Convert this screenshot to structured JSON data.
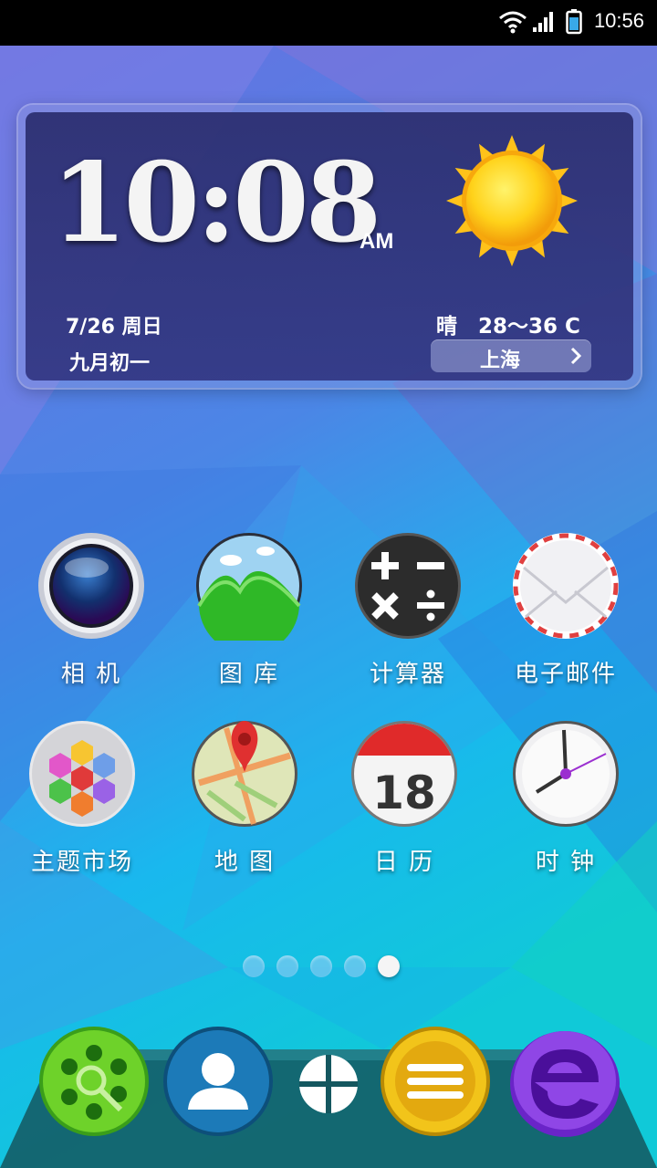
{
  "status_bar": {
    "time": "10:56"
  },
  "widget": {
    "time": "10:08",
    "ampm": "AM",
    "date": "7/26 周日",
    "lunar": "九月初一",
    "weather": "晴　28～36 C",
    "city": "上海"
  },
  "apps": [
    {
      "label": "相 机",
      "icon": "camera-icon"
    },
    {
      "label": "图 库",
      "icon": "gallery-icon"
    },
    {
      "label": "计算器",
      "icon": "calculator-icon"
    },
    {
      "label": "电子邮件",
      "icon": "email-icon"
    },
    {
      "label": "主题市场",
      "icon": "theme-store-icon"
    },
    {
      "label": "地 图",
      "icon": "maps-icon"
    },
    {
      "label": "日 历",
      "icon": "calendar-icon"
    },
    {
      "label": "时 钟",
      "icon": "clock-icon"
    }
  ],
  "calendar_day": "18",
  "page_indicator": {
    "count": 5,
    "active": 5
  },
  "dock": [
    {
      "icon": "dialer-icon"
    },
    {
      "icon": "contacts-icon"
    },
    {
      "icon": "app-drawer-icon"
    },
    {
      "icon": "messages-icon"
    },
    {
      "icon": "browser-icon"
    }
  ],
  "colors": {
    "accent": "#5a6fd6",
    "widget_bg": "#2a2d6e"
  }
}
